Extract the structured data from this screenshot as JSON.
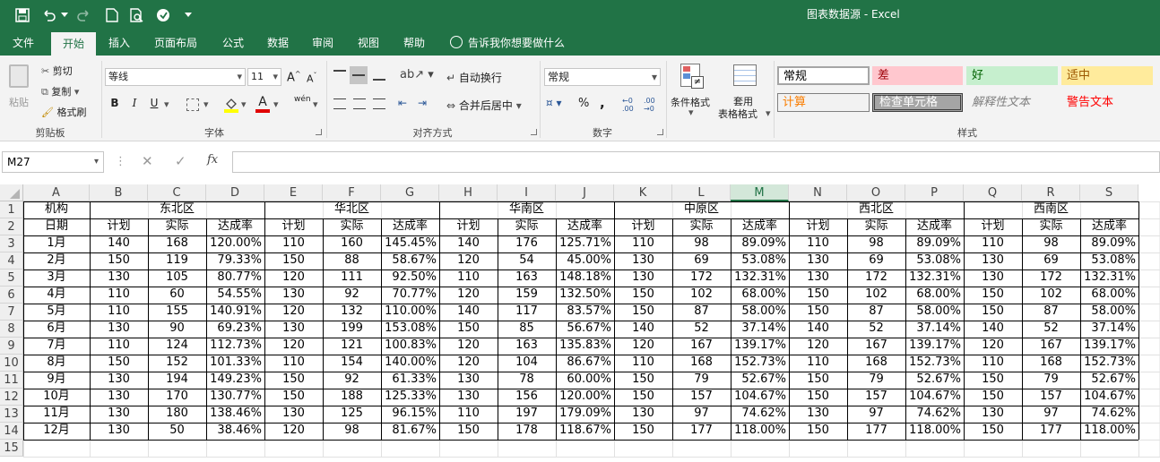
{
  "window": {
    "title": "图表数据源 - Excel"
  },
  "tabs": [
    "文件",
    "开始",
    "插入",
    "页面布局",
    "公式",
    "数据",
    "审阅",
    "视图",
    "帮助"
  ],
  "tell_me": "告诉我你想要做什么",
  "ribbon": {
    "clipboard": {
      "paste": "粘贴",
      "cut": "剪切",
      "copy": "复制",
      "format_painter": "格式刷",
      "label": "剪贴板"
    },
    "font": {
      "name": "等线",
      "size": "11",
      "bold": "B",
      "italic": "I",
      "underline": "U",
      "wen": "wén",
      "label": "字体"
    },
    "align": {
      "wrap": "自动换行",
      "merge": "合并后居中",
      "label": "对齐方式"
    },
    "number": {
      "format": "常规",
      "percent": "%",
      "comma": ",",
      "label": "数字"
    },
    "cond_format": "条件格式",
    "table_format_1": "套用",
    "table_format_2": "表格格式",
    "styles": {
      "normal": "常规",
      "bad": "差",
      "good": "好",
      "neutral": "适中",
      "calc": "计算",
      "check": "检查单元格",
      "explain": "解释性文本",
      "warn": "警告文本",
      "label": "样式"
    }
  },
  "name_box": "M27",
  "fx": "fx",
  "columns": [
    "A",
    "B",
    "C",
    "D",
    "E",
    "F",
    "G",
    "H",
    "I",
    "J",
    "K",
    "L",
    "M",
    "N",
    "O",
    "P",
    "Q",
    "R",
    "S"
  ],
  "selected_column": "M",
  "rows": [
    "1",
    "2",
    "3",
    "4",
    "5",
    "6",
    "7",
    "8",
    "9",
    "10",
    "11",
    "12",
    "13",
    "14",
    "15"
  ],
  "header1": {
    "a": "机构",
    "regions": [
      "东北区",
      "华北区",
      "华南区",
      "中原区",
      "西北区",
      "西南区"
    ]
  },
  "header2": {
    "a": "日期",
    "plan": "计划",
    "actual": "实际",
    "rate": "达成率"
  },
  "data": [
    [
      "1月",
      "140",
      "168",
      "120.00%",
      "110",
      "160",
      "145.45%",
      "140",
      "176",
      "125.71%",
      "110",
      "98",
      "89.09%",
      "110",
      "98",
      "89.09%",
      "110",
      "98",
      "89.09%"
    ],
    [
      "2月",
      "150",
      "119",
      "79.33%",
      "150",
      "88",
      "58.67%",
      "120",
      "54",
      "45.00%",
      "130",
      "69",
      "53.08%",
      "130",
      "69",
      "53.08%",
      "130",
      "69",
      "53.08%"
    ],
    [
      "3月",
      "130",
      "105",
      "80.77%",
      "120",
      "111",
      "92.50%",
      "110",
      "163",
      "148.18%",
      "130",
      "172",
      "132.31%",
      "130",
      "172",
      "132.31%",
      "130",
      "172",
      "132.31%"
    ],
    [
      "4月",
      "110",
      "60",
      "54.55%",
      "130",
      "92",
      "70.77%",
      "120",
      "159",
      "132.50%",
      "150",
      "102",
      "68.00%",
      "150",
      "102",
      "68.00%",
      "150",
      "102",
      "68.00%"
    ],
    [
      "5月",
      "110",
      "155",
      "140.91%",
      "120",
      "132",
      "110.00%",
      "140",
      "117",
      "83.57%",
      "150",
      "87",
      "58.00%",
      "150",
      "87",
      "58.00%",
      "150",
      "87",
      "58.00%"
    ],
    [
      "6月",
      "130",
      "90",
      "69.23%",
      "130",
      "199",
      "153.08%",
      "150",
      "85",
      "56.67%",
      "140",
      "52",
      "37.14%",
      "140",
      "52",
      "37.14%",
      "140",
      "52",
      "37.14%"
    ],
    [
      "7月",
      "110",
      "124",
      "112.73%",
      "120",
      "121",
      "100.83%",
      "120",
      "163",
      "135.83%",
      "120",
      "167",
      "139.17%",
      "120",
      "167",
      "139.17%",
      "120",
      "167",
      "139.17%"
    ],
    [
      "8月",
      "150",
      "152",
      "101.33%",
      "110",
      "154",
      "140.00%",
      "120",
      "104",
      "86.67%",
      "110",
      "168",
      "152.73%",
      "110",
      "168",
      "152.73%",
      "110",
      "168",
      "152.73%"
    ],
    [
      "9月",
      "130",
      "194",
      "149.23%",
      "150",
      "92",
      "61.33%",
      "130",
      "78",
      "60.00%",
      "150",
      "79",
      "52.67%",
      "150",
      "79",
      "52.67%",
      "150",
      "79",
      "52.67%"
    ],
    [
      "10月",
      "130",
      "170",
      "130.77%",
      "150",
      "188",
      "125.33%",
      "130",
      "156",
      "120.00%",
      "150",
      "157",
      "104.67%",
      "150",
      "157",
      "104.67%",
      "150",
      "157",
      "104.67%"
    ],
    [
      "11月",
      "130",
      "180",
      "138.46%",
      "130",
      "125",
      "96.15%",
      "110",
      "197",
      "179.09%",
      "130",
      "97",
      "74.62%",
      "130",
      "97",
      "74.62%",
      "130",
      "97",
      "74.62%"
    ],
    [
      "12月",
      "130",
      "50",
      "38.46%",
      "120",
      "98",
      "81.67%",
      "150",
      "178",
      "118.67%",
      "150",
      "177",
      "118.00%",
      "150",
      "177",
      "118.00%",
      "150",
      "177",
      "118.00%"
    ]
  ]
}
